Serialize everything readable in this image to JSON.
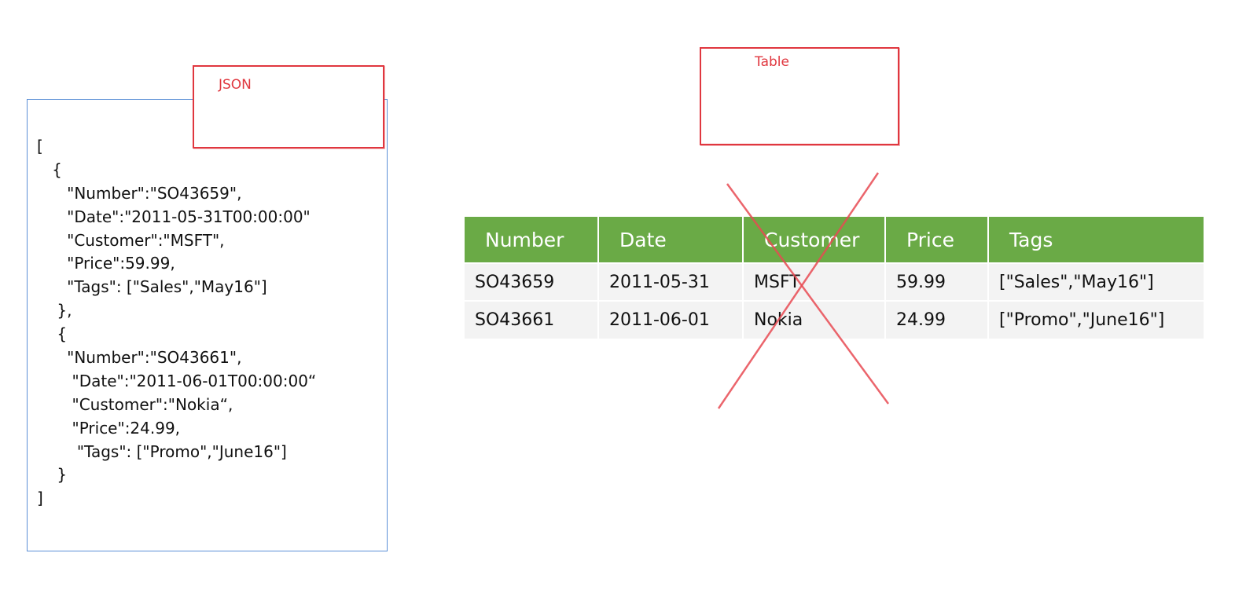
{
  "callouts": {
    "json_label": "JSON",
    "table_label": "Table"
  },
  "json_lines": [
    "[",
    "   {",
    "      \"Number\":\"SO43659\",",
    "      \"Date\":\"2011-05-31T00:00:00\"",
    "      \"Customer\":\"MSFT\",",
    "      \"Price\":59.99,",
    "      \"Tags\": [\"Sales\",\"May16\"]",
    "    },",
    "    {",
    "      \"Number\":\"SO43661\",",
    "       \"Date\":\"2011-06-01T00:00:00“",
    "       \"Customer\":\"Nokia“,",
    "       \"Price\":24.99,",
    "        \"Tags\": [\"Promo\",\"June16\"]",
    "    }",
    "]"
  ],
  "table": {
    "headers": [
      "Number",
      "Date",
      "Customer",
      "Price",
      "Tags"
    ],
    "rows": [
      [
        "SO43659",
        "2011-05-31",
        "MSFT",
        "59.99",
        "[\"Sales\",\"May16\"]"
      ],
      [
        "SO43661",
        "2011-06-01",
        "Nokia",
        "24.99",
        "[\"Promo\",\"June16\"]"
      ]
    ]
  },
  "colors": {
    "header_green": "#6aaa46",
    "callout_red": "#e0373f",
    "panel_blue": "#5b8fd6",
    "row_gray": "#f3f3f3"
  }
}
